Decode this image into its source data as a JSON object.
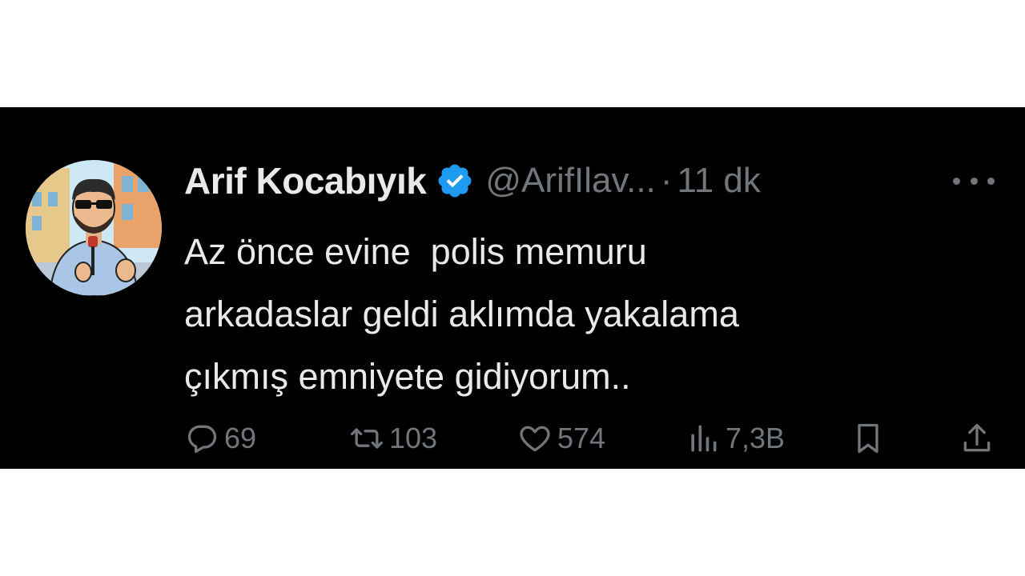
{
  "tweet": {
    "author_name": "Arif Kocabıyık",
    "handle": "@ArifIlav...",
    "separator": "·",
    "time": "11 dk",
    "body": "Az önce evine  polis memuru\narkadaslar geldi aklımda yakalama\nçıkmış emniyete gidiyorum..",
    "verified_color": "#1d9bf0"
  },
  "actions": {
    "replies": "69",
    "retweets": "103",
    "likes": "574",
    "views": "7,3B"
  },
  "icons": [
    "avatar",
    "verified-badge-icon",
    "more-icon",
    "reply-icon",
    "retweet-icon",
    "like-icon",
    "views-icon",
    "bookmark-icon",
    "share-icon"
  ]
}
